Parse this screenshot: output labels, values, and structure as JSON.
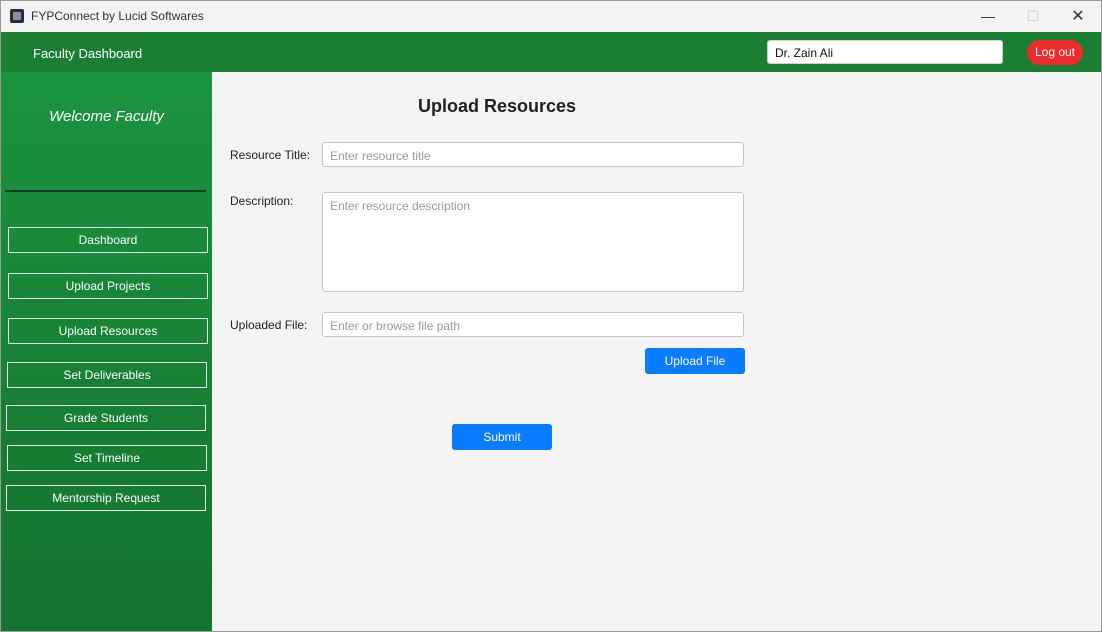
{
  "window": {
    "title": "FYPConnect by Lucid Softwares",
    "controls": {
      "minimize": "—",
      "maximize": "☐",
      "close": "✕"
    }
  },
  "topbar": {
    "title": "Faculty Dashboard",
    "user_name": "Dr. Zain Ali",
    "logout_label": "Log out"
  },
  "sidebar": {
    "welcome": "Welcome Faculty",
    "items": [
      {
        "label": "Dashboard"
      },
      {
        "label": "Upload Projects"
      },
      {
        "label": "Upload Resources"
      },
      {
        "label": "Set Deliverables"
      },
      {
        "label": "Grade Students"
      },
      {
        "label": "Set Timeline"
      },
      {
        "label": "Mentorship Request"
      }
    ]
  },
  "form": {
    "heading": "Upload Resources",
    "title_label": "Resource Title:",
    "title_placeholder": "Enter resource title",
    "description_label": "Description:",
    "description_placeholder": "Enter resource description",
    "file_label": "Uploaded File:",
    "file_placeholder": "Enter or browse file path",
    "upload_label": "Upload File",
    "submit_label": "Submit"
  },
  "colors": {
    "accent_green": "#1b7f33",
    "primary_blue": "#0a7cff",
    "logout_red": "#ee2b2b"
  }
}
